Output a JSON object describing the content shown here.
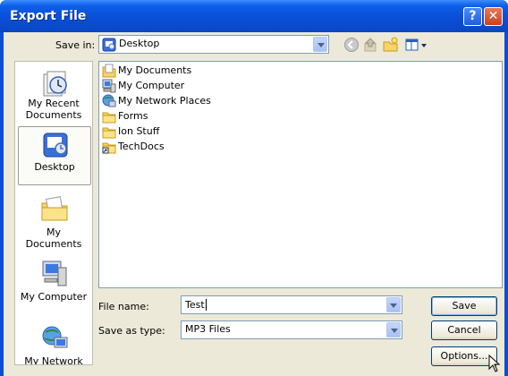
{
  "window": {
    "title": "Export File",
    "help_glyph": "?",
    "close_glyph": "✕"
  },
  "toolbar": {
    "save_in_label": "Save in:",
    "save_in_value": "Desktop",
    "icons": [
      "back-icon",
      "up-folder-icon",
      "new-folder-icon",
      "views-menu-icon"
    ]
  },
  "places": [
    {
      "label": "My Recent Documents",
      "icon": "recent-documents-icon"
    },
    {
      "label": "Desktop",
      "icon": "desktop-icon",
      "selected": true
    },
    {
      "label": "My Documents",
      "icon": "my-documents-icon"
    },
    {
      "label": "My Computer",
      "icon": "my-computer-icon"
    },
    {
      "label": "My Network",
      "icon": "my-network-icon"
    }
  ],
  "files": [
    {
      "name": "My Documents",
      "icon": "documents-folder-icon"
    },
    {
      "name": "My Computer",
      "icon": "computer-icon"
    },
    {
      "name": "My Network Places",
      "icon": "network-icon"
    },
    {
      "name": "Forms",
      "icon": "folder-icon"
    },
    {
      "name": "Ion Stuff",
      "icon": "folder-icon"
    },
    {
      "name": "TechDocs",
      "icon": "shortcut-folder-icon"
    }
  ],
  "form": {
    "file_name_label": "File name:",
    "file_name_value": "Test",
    "save_as_type_label": "Save as type:",
    "save_as_type_value": "MP3 Files"
  },
  "buttons": {
    "save": "Save",
    "cancel": "Cancel",
    "options": "Options..."
  },
  "colors": {
    "titlebar": "#0a4fd6",
    "dialog_bg": "#ece9d8",
    "border": "#7f9db9"
  }
}
